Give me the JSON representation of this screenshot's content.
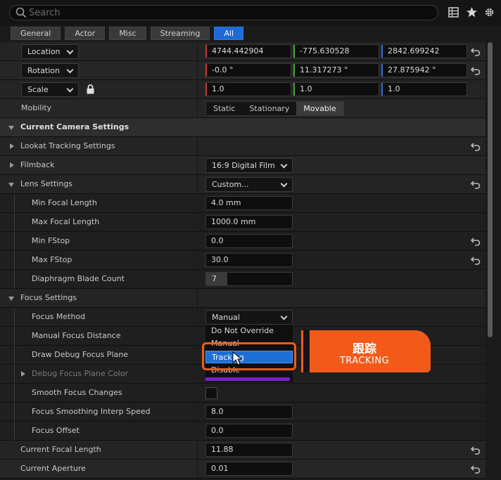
{
  "search": {
    "placeholder": "Search"
  },
  "toolbar_icons": [
    "table-view-icon",
    "star-icon",
    "gear-icon"
  ],
  "tabs": [
    {
      "label": "General",
      "active": false
    },
    {
      "label": "Actor",
      "active": false
    },
    {
      "label": "Misc",
      "active": false
    },
    {
      "label": "Streaming",
      "active": false
    },
    {
      "label": "All",
      "active": true
    }
  ],
  "transform": {
    "location": {
      "label": "Location",
      "x": "4744.442904",
      "y": "-775.630528",
      "z": "2842.699242"
    },
    "rotation": {
      "label": "Rotation",
      "x": "-0.0 °",
      "y": "11.317273 °",
      "z": "27.875942 °"
    },
    "scale": {
      "label": "Scale",
      "x": "1.0",
      "y": "1.0",
      "z": "1.0"
    },
    "mobility": {
      "label": "Mobility",
      "options": [
        "Static",
        "Stationary",
        "Movable"
      ],
      "selected": "Movable"
    }
  },
  "camera": {
    "section_title": "Current Camera Settings",
    "lookat": "Lookat Tracking Settings",
    "filmback": {
      "label": "Filmback",
      "value": "16:9 Digital Film"
    },
    "lens": {
      "label": "Lens Settings",
      "value": "Custom..."
    },
    "min_focal": {
      "label": "Min Focal Length",
      "value": "4.0 mm"
    },
    "max_focal": {
      "label": "Max Focal Length",
      "value": "1000.0 mm"
    },
    "min_fstop": {
      "label": "Min FStop",
      "value": "0.0"
    },
    "max_fstop": {
      "label": "Max FStop",
      "value": "30.0"
    },
    "blades": {
      "label": "Diaphragm Blade Count",
      "value": "7"
    },
    "focus": {
      "section": "Focus Settings",
      "method": {
        "label": "Focus Method",
        "value": "Manual"
      },
      "manual_distance": "Manual Focus Distance",
      "draw_debug": "Draw Debug Focus Plane",
      "debug_color": "Debug Focus Plane Color",
      "smooth": "Smooth Focus Changes",
      "smooth_speed": {
        "label": "Focus Smoothing Interp Speed",
        "value": "8.0"
      },
      "offset": {
        "label": "Focus Offset",
        "value": "0.0"
      }
    },
    "current_focal": {
      "label": "Current Focal Length",
      "value": "11.88"
    },
    "current_aperture": {
      "label": "Current Aperture",
      "value": "0.01"
    }
  },
  "dropdown": {
    "options": [
      "Do Not Override",
      "Manual",
      "Tracking",
      "Disable"
    ],
    "selected": "Tracking"
  },
  "badge": {
    "cn": "跟踪",
    "en": "TRACKING",
    "color": "#f25a1a"
  },
  "colors": {
    "accent": "#1f6ad4",
    "highlight": "#f25a1a",
    "x_axis": "#c43c3c",
    "y_axis": "#46a83a",
    "z_axis": "#3a6ad0"
  }
}
